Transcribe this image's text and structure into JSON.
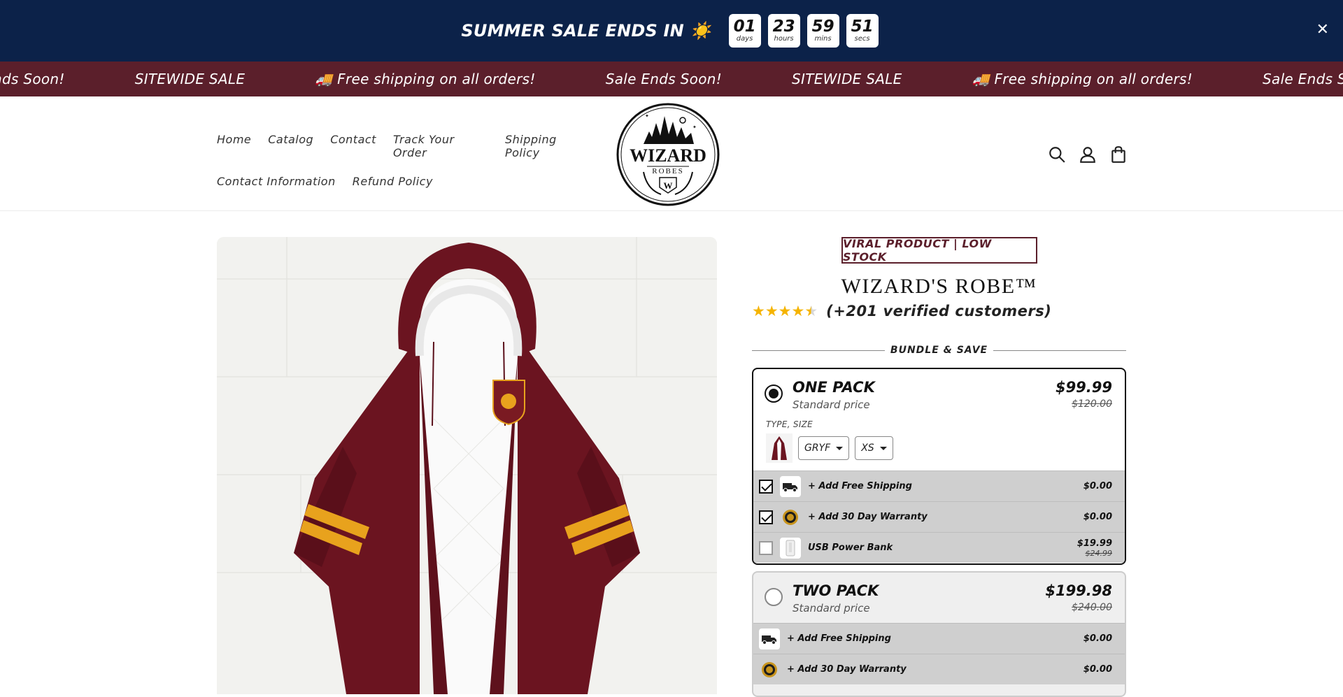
{
  "countdown": {
    "title": "SUMMER SALE ENDS IN ☀️",
    "units": [
      {
        "value": "01",
        "label": "days"
      },
      {
        "value": "23",
        "label": "hours"
      },
      {
        "value": "59",
        "label": "mins"
      },
      {
        "value": "51",
        "label": "secs"
      }
    ],
    "close_label": "✕"
  },
  "marquee": {
    "items": [
      "nds Soon!",
      "SITEWIDE SALE",
      "🚚 Free shipping on all orders!",
      "Sale Ends Soon!",
      "SITEWIDE SALE",
      "🚚 Free shipping on all orders!",
      "Sale Ends Soon!"
    ]
  },
  "nav": {
    "row1": [
      "Home",
      "Catalog",
      "Contact",
      "Track Your Order",
      "Shipping Policy"
    ],
    "row2": [
      "Contact Information",
      "Refund Policy"
    ]
  },
  "logo": {
    "line1": "WIZARD",
    "line2": "ROBES",
    "mark": "W"
  },
  "product": {
    "badge": "VIRAL PRODUCT | LOW STOCK",
    "title": "WIZARD'S ROBE™",
    "rating_text": "(+201 verified customers)",
    "rating_value": 4.5,
    "bundle_label": "BUNDLE & SAVE"
  },
  "packs": [
    {
      "name": "ONE PACK",
      "subtitle": "Standard price",
      "price": "$99.99",
      "old_price": "$120.00",
      "selected": true,
      "type_size_label": "TYPE, SIZE",
      "type_value": "GRYF",
      "size_value": "XS",
      "addons": [
        {
          "label": "+ Add Free Shipping",
          "price": "$0.00",
          "checked": true,
          "icon": "truck-icon"
        },
        {
          "label": "+ Add 30 Day Warranty",
          "price": "$0.00",
          "checked": true,
          "icon": "warranty-badge-icon"
        },
        {
          "label": "USB Power Bank",
          "price": "$19.99",
          "old_price": "$24.99",
          "checked": false,
          "icon": "power-bank-icon"
        }
      ]
    },
    {
      "name": "TWO PACK",
      "subtitle": "Standard price",
      "price": "$199.98",
      "old_price": "$240.00",
      "selected": false,
      "addons": [
        {
          "label": "+ Add Free Shipping",
          "price": "$0.00",
          "icon": "truck-icon"
        },
        {
          "label": "+ Add 30 Day Warranty",
          "price": "$0.00",
          "icon": "warranty-badge-icon"
        }
      ]
    }
  ],
  "colors": {
    "countdown_bg": "#0c2249",
    "marquee_bg": "#5b1f2b",
    "star": "#f5b400",
    "robe": "#6b1420",
    "stripe": "#e8a21d"
  }
}
